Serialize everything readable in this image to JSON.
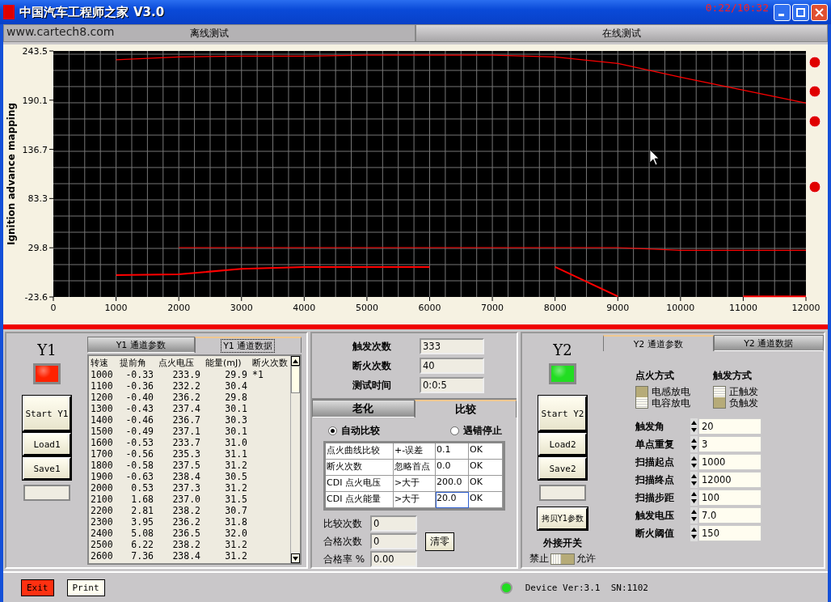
{
  "window": {
    "title": "中国汽车工程师之家",
    "version": "V3.0",
    "clock": "0:22/10:32"
  },
  "website": "www.cartech8.com",
  "mode_tabs": [
    {
      "label": "离线测试",
      "selected": true
    },
    {
      "label": "在线测试",
      "selected": false
    }
  ],
  "chart_data": {
    "type": "line",
    "grid": true,
    "ylabel": "Ignition advance mapping",
    "x": [
      1000,
      2000,
      3000,
      4000,
      5000,
      6000,
      7000,
      8000,
      9000,
      10000,
      11000,
      12000
    ],
    "xlim": [
      0,
      12000
    ],
    "ylim": [
      -23.6,
      243.5
    ],
    "xticks": [
      0,
      1000,
      2000,
      3000,
      4000,
      5000,
      6000,
      7000,
      8000,
      9000,
      10000,
      11000,
      12000
    ],
    "yticks": [
      -23.6,
      29.8,
      83.3,
      136.7,
      190.1,
      243.5
    ],
    "series": [
      {
        "color": "#ff0000",
        "values": [
          234,
          237,
          238,
          238,
          239,
          239,
          239,
          237,
          230,
          215,
          201,
          187
        ]
      },
      {
        "color": "#ff0000",
        "values": [
          null,
          30,
          30,
          30,
          30,
          30,
          30,
          30,
          30,
          27,
          27,
          27
        ]
      },
      {
        "color": "#ff0000",
        "values": [
          0,
          1,
          7,
          9,
          9,
          9,
          null,
          9,
          -23,
          null,
          -23,
          -23
        ]
      }
    ]
  },
  "y1_panel": {
    "name": "Y1",
    "led_ok": false,
    "buttons": [
      "Start Y1",
      "Load1",
      "Save1"
    ],
    "tabs": [
      {
        "label": "Y1 通道参数",
        "selected": false
      },
      {
        "label": "Y1 通道数据",
        "selected": true
      }
    ],
    "table": {
      "columns": [
        "转速",
        "提前角",
        "点火电压",
        "能量(mJ)",
        "断火次数"
      ],
      "rows": [
        [
          "1000",
          "-0.33",
          "233.9",
          "29.9",
          "*1"
        ],
        [
          "1100",
          "-0.36",
          "232.2",
          "30.4"
        ],
        [
          "1200",
          "-0.40",
          "236.2",
          "29.8"
        ],
        [
          "1300",
          "-0.43",
          "237.4",
          "30.1"
        ],
        [
          "1400",
          "-0.46",
          "236.7",
          "30.3"
        ],
        [
          "1500",
          "-0.49",
          "237.1",
          "30.1"
        ],
        [
          "1600",
          "-0.53",
          "233.7",
          "31.0"
        ],
        [
          "1700",
          "-0.56",
          "235.3",
          "31.1"
        ],
        [
          "1800",
          "-0.58",
          "237.5",
          "31.2"
        ],
        [
          "1900",
          "-0.63",
          "238.4",
          "30.5"
        ],
        [
          "2000",
          "0.53",
          "237.3",
          "31.2"
        ],
        [
          "2100",
          "1.68",
          "237.0",
          "31.5"
        ],
        [
          "2200",
          "2.81",
          "238.2",
          "30.7"
        ],
        [
          "2300",
          "3.95",
          "236.2",
          "31.8"
        ],
        [
          "2400",
          "5.08",
          "236.5",
          "32.0"
        ],
        [
          "2500",
          "6.22",
          "238.2",
          "31.2"
        ],
        [
          "2600",
          "7.36",
          "238.4",
          "31.2"
        ]
      ]
    }
  },
  "counters": [
    {
      "label": "触发次数",
      "value": "333"
    },
    {
      "label": "断火次数",
      "value": "40"
    },
    {
      "label": "测试时间",
      "value": "0:0:5"
    }
  ],
  "test_tabs": [
    {
      "label": "老化",
      "selected": false
    },
    {
      "label": "比较",
      "selected": true
    }
  ],
  "compare_modes": [
    {
      "label": "自动比较",
      "selected": true
    },
    {
      "label": "遇错停止",
      "selected": false
    }
  ],
  "compare_table": {
    "rows": [
      [
        "点火曲线比较",
        "+-误差",
        "0.1",
        "OK"
      ],
      [
        "断火次数",
        "忽略首点",
        "0.0",
        "OK"
      ],
      [
        "CDI 点火电压",
        ">大于",
        "200.0",
        "OK"
      ],
      [
        "CDI 点火能量",
        ">大于",
        "20.0",
        "OK"
      ]
    ]
  },
  "stats": [
    {
      "label": "比较次数",
      "value": "0"
    },
    {
      "label": "合格次数",
      "value": "0"
    },
    {
      "label": "合格率 %",
      "value": "0.00"
    }
  ],
  "clear_button": "清零",
  "y2_panel": {
    "name": "Y2",
    "led_ok": true,
    "buttons": [
      "Start Y2",
      "Load2",
      "Save2"
    ],
    "copy_button": "拷贝Y1参数",
    "external_switch": {
      "label": "外接开关",
      "off_label": "禁止",
      "on_label": "允许",
      "on": false
    },
    "tabs": [
      {
        "label": "Y2 通道参数",
        "selected": true
      },
      {
        "label": "Y2 通道数据",
        "selected": false
      }
    ],
    "ignition_mode": {
      "label": "点火方式",
      "options": [
        {
          "label": "电感放电",
          "selected": false
        },
        {
          "label": "电容放电",
          "selected": true
        }
      ]
    },
    "trigger_mode": {
      "label": "触发方式",
      "options": [
        {
          "label": "正触发",
          "selected": true
        },
        {
          "label": "负触发",
          "selected": false
        }
      ]
    },
    "params": [
      {
        "label": "触发角",
        "value": "20"
      },
      {
        "label": "单点重复",
        "value": "3"
      },
      {
        "label": "扫描起点",
        "value": "1000"
      },
      {
        "label": "扫描终点",
        "value": "12000"
      },
      {
        "label": "扫描步距",
        "value": "100"
      },
      {
        "label": "触发电压",
        "value": "7.0"
      },
      {
        "label": "断火阈值",
        "value": "150"
      }
    ]
  },
  "status_bar": {
    "buttons": [
      {
        "label": "Exit",
        "kind": "danger"
      },
      {
        "label": "Print",
        "kind": "normal"
      }
    ],
    "device_connected": true,
    "device_info": "Device Ver:3.1  SN:1102"
  }
}
